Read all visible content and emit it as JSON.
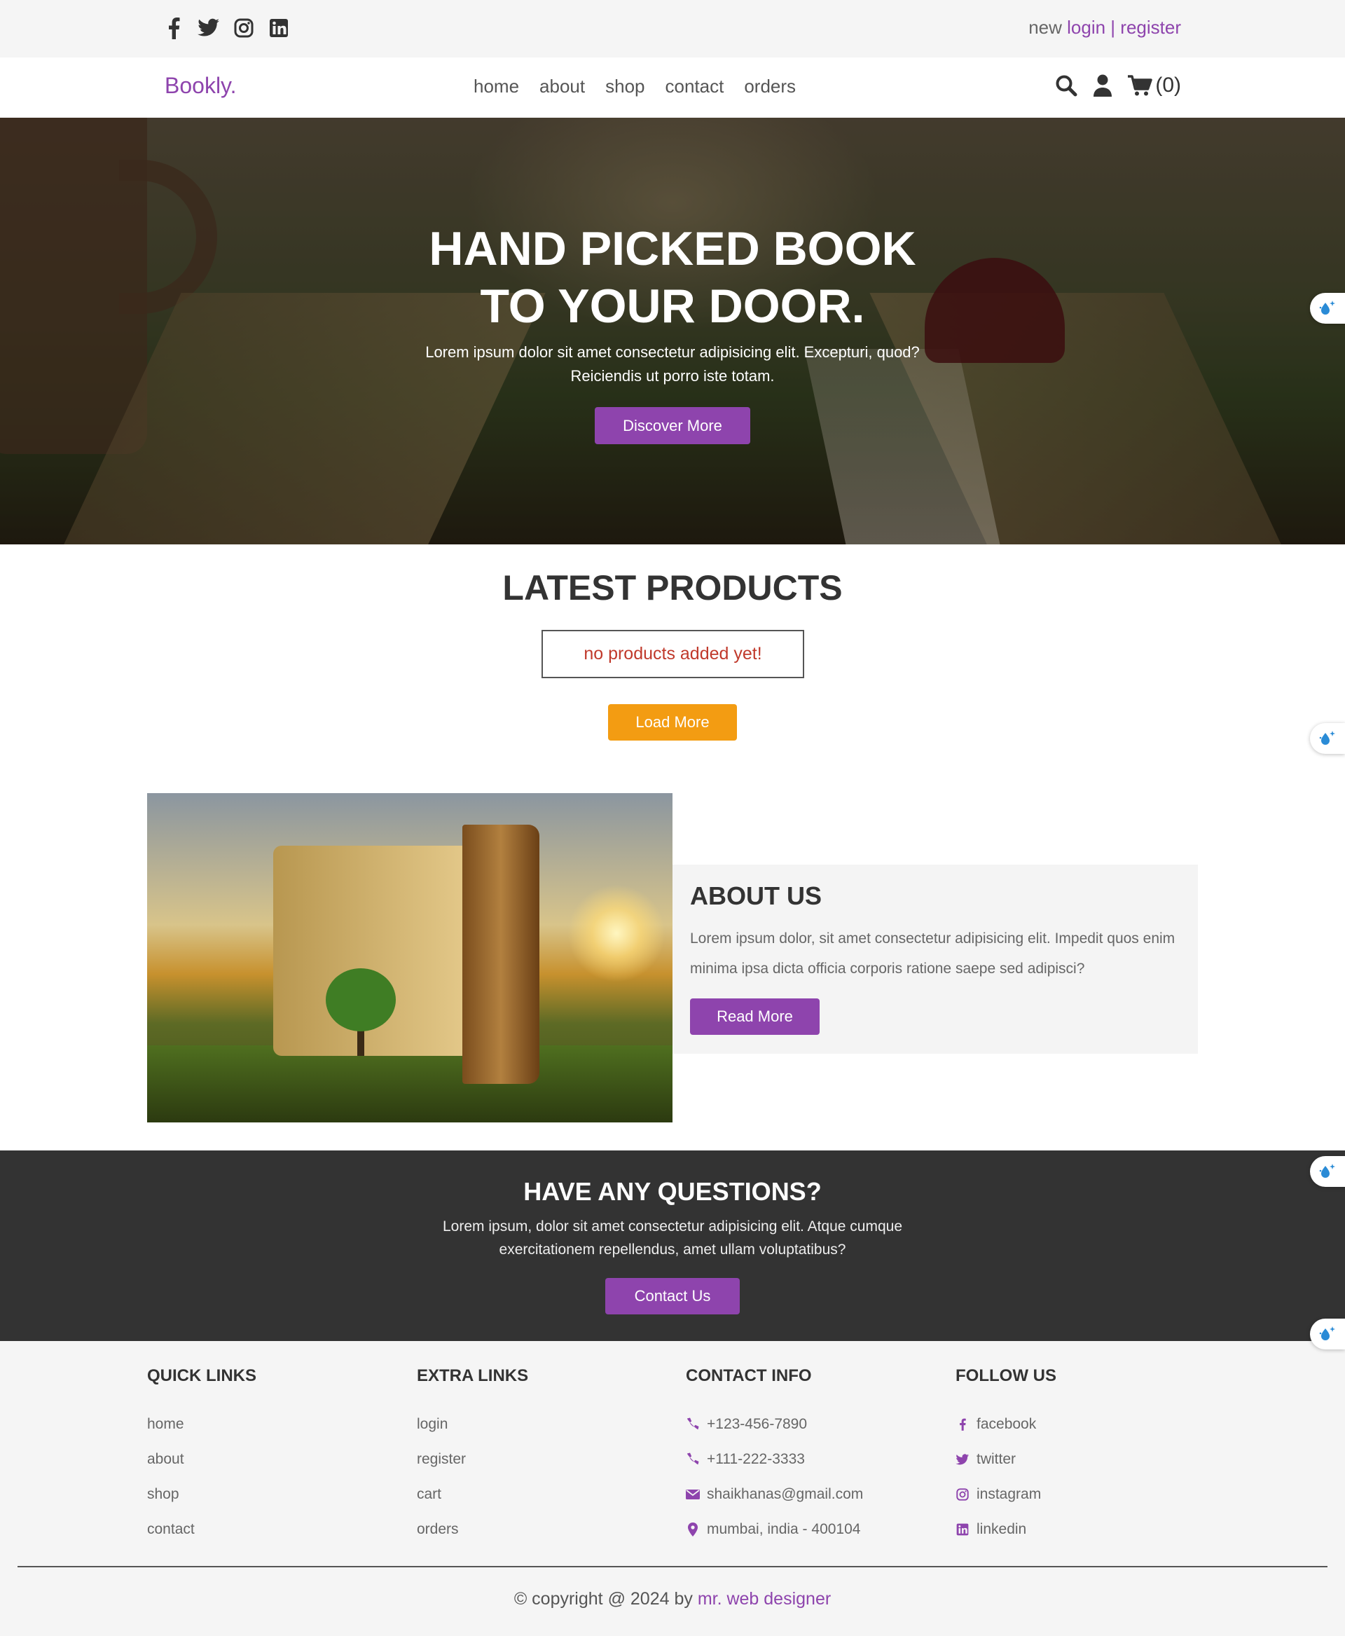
{
  "topbar": {
    "social": [
      "facebook-icon",
      "twitter-icon",
      "instagram-icon",
      "linkedin-icon"
    ],
    "auth_prefix": "new",
    "login": "login",
    "separator": "|",
    "register": "register"
  },
  "header": {
    "logo": "Bookly.",
    "nav": [
      "home",
      "about",
      "shop",
      "contact",
      "orders"
    ],
    "cart_count": "(0)"
  },
  "hero": {
    "title_line1": "HAND PICKED BOOK",
    "title_line2": "TO YOUR DOOR.",
    "text": "Lorem ipsum dolor sit amet consectetur adipisicing elit. Excepturi, quod? Reiciendis ut porro iste totam.",
    "button": "Discover More"
  },
  "products": {
    "title": "LATEST PRODUCTS",
    "empty": "no products added yet!",
    "load_more": "Load More"
  },
  "about": {
    "title": "ABOUT US",
    "text": "Lorem ipsum dolor, sit amet consectetur adipisicing elit. Impedit quos enim minima ipsa dicta officia corporis ratione saepe sed adipisci?",
    "button": "Read More"
  },
  "questions": {
    "title": "HAVE ANY QUESTIONS?",
    "text": "Lorem ipsum, dolor sit amet consectetur adipisicing elit. Atque cumque exercitationem repellendus, amet ullam voluptatibus?",
    "button": "Contact Us"
  },
  "footer": {
    "quick": {
      "title": "QUICK LINKS",
      "items": [
        "home",
        "about",
        "shop",
        "contact"
      ]
    },
    "extra": {
      "title": "EXTRA LINKS",
      "items": [
        "login",
        "register",
        "cart",
        "orders"
      ]
    },
    "contact": {
      "title": "CONTACT INFO",
      "items": [
        "+123-456-7890",
        "+111-222-3333",
        "shaikhanas@gmail.com",
        "mumbai, india - 400104"
      ]
    },
    "follow": {
      "title": "FOLLOW US",
      "items": [
        "facebook",
        "twitter",
        "instagram",
        "linkedin"
      ]
    },
    "copyright_prefix": "© copyright @ 2024 by",
    "copyright_link": "mr. web designer"
  },
  "colors": {
    "accent": "#8e44ad",
    "orange": "#f39c12",
    "dark": "#333333",
    "error": "#c0392b"
  }
}
